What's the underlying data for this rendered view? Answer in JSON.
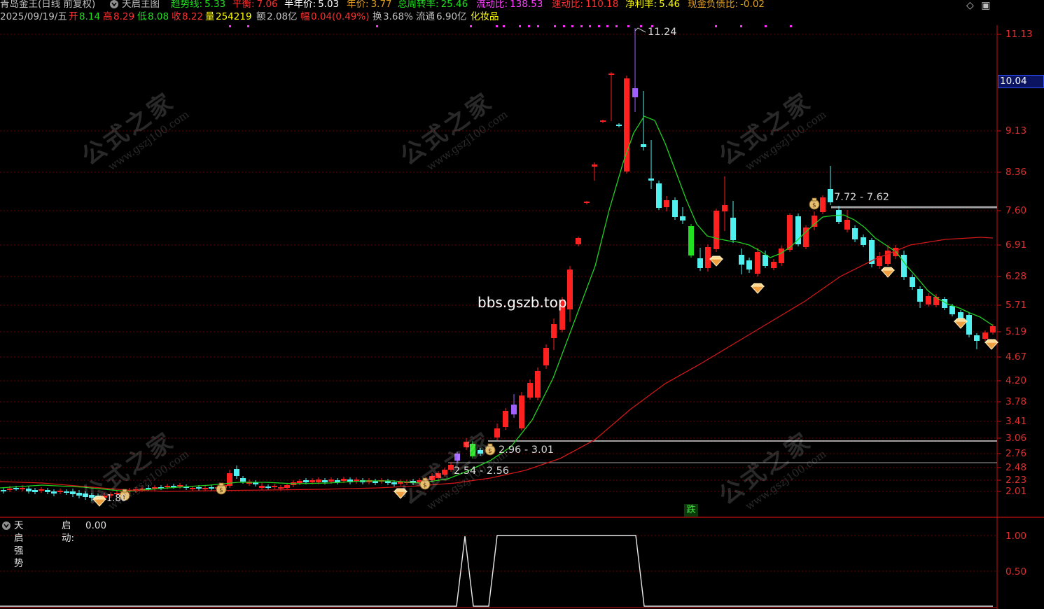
{
  "header": {
    "title": "青岛金王(日线 前复权)",
    "indicator_name": "天启主图",
    "metrics": [
      {
        "label": "趋势线:",
        "value": "5.33",
        "color": "#20e020"
      },
      {
        "label": "平衡:",
        "value": "7.06",
        "color": "#ff3030"
      },
      {
        "label": "半年价:",
        "value": "5.03",
        "color": "#ffffff"
      },
      {
        "label": "年价:",
        "value": "3.77",
        "color": "#e0a020"
      },
      {
        "label": "总周转率:",
        "value": "25.46",
        "color": "#20e020"
      },
      {
        "label": "流动比:",
        "value": "138.53",
        "color": "#ff40ff"
      },
      {
        "label": "速动比:",
        "value": "110.18",
        "color": "#ff3030"
      },
      {
        "label": "净利率:",
        "value": "5.46",
        "color": "#ffff00"
      },
      {
        "label": "现金负债比:",
        "value": "-0.02",
        "color": "#e0a020"
      }
    ]
  },
  "quote": {
    "date": "2025/09/19/五",
    "open_label": "开",
    "open": "8.14",
    "high_label": "高",
    "high": "8.29",
    "low_label": "低",
    "low": "8.08",
    "close_label": "收",
    "close": "8.22",
    "volume_label": "量",
    "volume": "254219",
    "amount_label": "额",
    "amount": "2.08亿",
    "change_label": "幅",
    "change": "0.04(0.49%)",
    "turnover_label": "换",
    "turnover": "3.68%",
    "float_label": "流通",
    "float": "6.90亿",
    "sector": "化妆品"
  },
  "price_axis": {
    "labels": [
      "11.13",
      "9.13",
      "8.36",
      "7.60",
      "6.91",
      "6.28",
      "5.71",
      "5.19",
      "4.67",
      "4.20",
      "3.78",
      "3.41",
      "3.06",
      "2.76",
      "2.48",
      "2.23",
      "2.01"
    ],
    "current_price": "10.04"
  },
  "annotations": {
    "peak": "11.24",
    "low": "1.80",
    "level_1": "7.72 - 7.62",
    "level_2": "2.96 - 3.01",
    "level_3": "2.54 - 2.56",
    "site": "bbs.gszb.top",
    "fall_marker": "跌"
  },
  "watermark": {
    "text": "公式之家",
    "url": "www.gszj100.com"
  },
  "sub_panel": {
    "name": "天启强势",
    "value_label": "启动:",
    "value": "0.00",
    "axis_labels": [
      "1.00",
      "0.50"
    ]
  },
  "colors": {
    "up": "#ff2020",
    "down": "#50f0f0",
    "ma_fast": "#20d020",
    "ma_slow": "#d01818",
    "grid": "#6a0000",
    "axis": "#c81010"
  },
  "icons": [
    "collapse-icon",
    "diamond-icon",
    "window-icon",
    "money-bag-icon",
    "gem-icon"
  ]
}
